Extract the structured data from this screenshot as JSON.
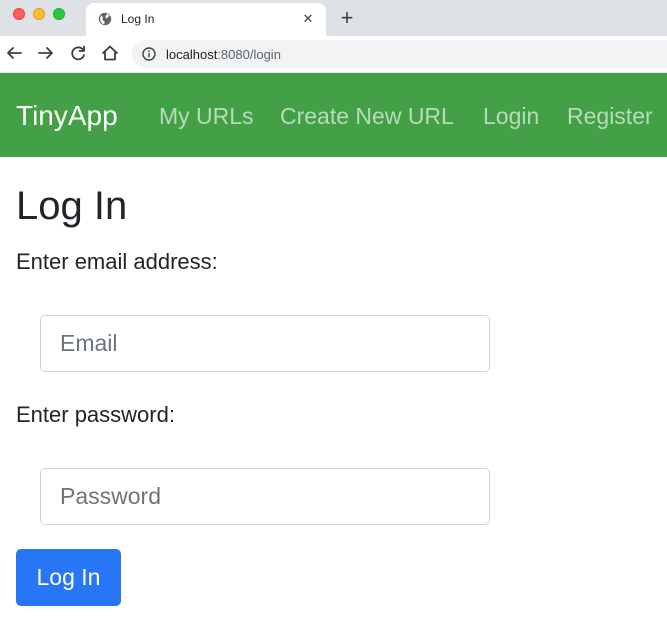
{
  "browser": {
    "tab_title": "Log In",
    "tab_close": "✕",
    "new_tab": "+",
    "url_host": "localhost",
    "url_path": ":8080/login"
  },
  "navbar": {
    "brand": "TinyApp",
    "links": [
      "My URLs",
      "Create New URL",
      "Login",
      "Register"
    ],
    "color": "#43a047"
  },
  "form": {
    "heading": "Log In",
    "email_label": "Enter email address:",
    "email_placeholder": "Email",
    "email_value": "",
    "password_label": "Enter password:",
    "password_placeholder": "Password",
    "password_value": "",
    "submit_label": "Log In",
    "submit_color": "#2776f5"
  },
  "icons": {
    "tab": "globe-icon",
    "back": "arrow-left-icon",
    "forward": "arrow-right-icon",
    "reload": "reload-icon",
    "home": "home-icon",
    "site_info": "info-icon"
  }
}
